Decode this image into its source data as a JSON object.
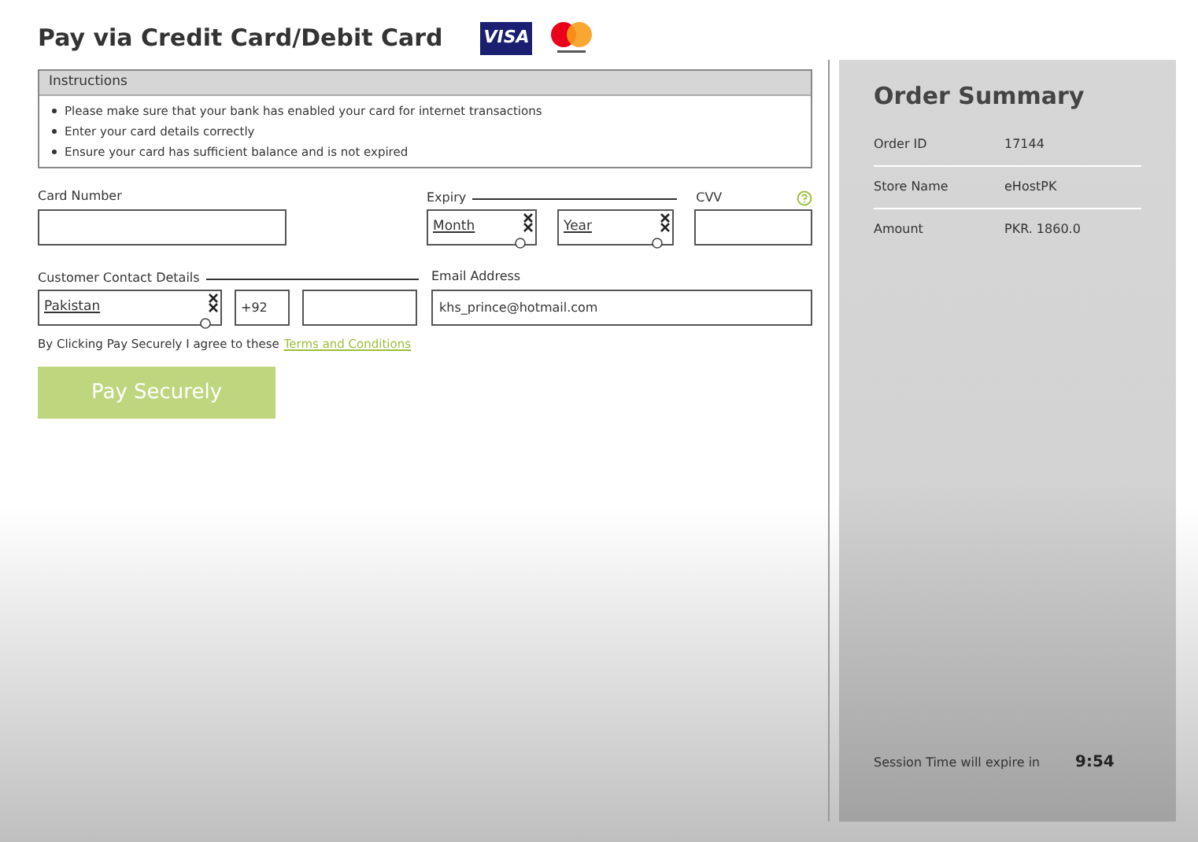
{
  "title": "Pay via Credit Card/Debit Card",
  "logos": [
    {
      "kind": "visa",
      "text": "VISA"
    },
    {
      "kind": "mastercard"
    }
  ],
  "instructions": {
    "heading": "Instructions",
    "items": [
      "Please make sure that your bank has enabled your card for internet transactions",
      "Enter your card details correctly",
      "Ensure your card has sufficient balance and is not expired"
    ]
  },
  "card_number": {
    "label": "Card Number"
  },
  "expiry": {
    "label": "Expiry",
    "month": "Month",
    "year": "Year"
  },
  "cvv": {
    "label": "CVV"
  },
  "contact": {
    "label": "Customer Contact Details",
    "country": "Pakistan",
    "code": "+92"
  },
  "email": {
    "label": "Email Address",
    "value": "khs_prince@hotmail.com"
  },
  "agreement": {
    "text": "By Clicking Pay Securely I agree to these",
    "link": "Terms and Conditions"
  },
  "pay_button": "Pay Securely",
  "summary": {
    "title": "Order Summary",
    "rows": [
      {
        "label": "Order ID",
        "value": "17144"
      },
      {
        "label": "Store Name",
        "value": "eHostPK"
      },
      {
        "label": "Amount",
        "value": "PKR. 1860.0"
      }
    ],
    "session_label": "Session Time will expire in",
    "session_time": "9:54"
  }
}
